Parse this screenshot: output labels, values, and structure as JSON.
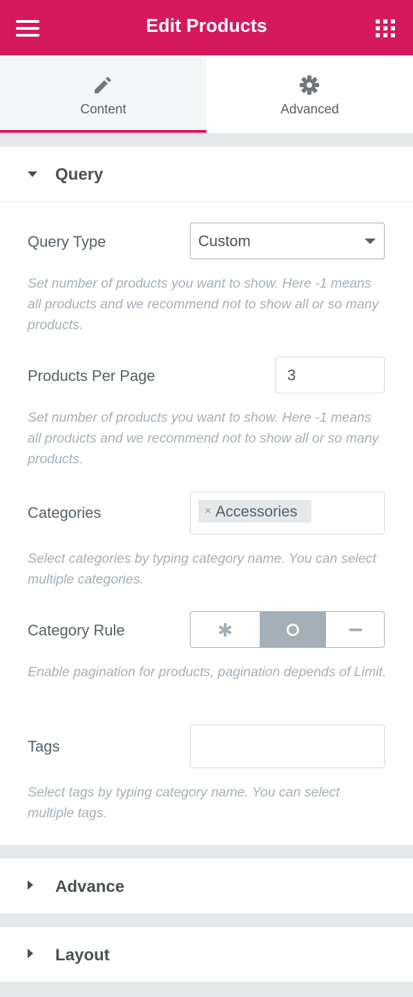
{
  "header": {
    "title": "Edit Products",
    "menu_icon": "hamburger-menu-icon",
    "apps_icon": "grid-icon",
    "background": "#d5195c"
  },
  "tabs": [
    {
      "label": "Content",
      "icon": "pencil-icon",
      "active": true
    },
    {
      "label": "Advanced",
      "icon": "gear-icon",
      "active": false
    }
  ],
  "sections": {
    "query": {
      "title": "Query",
      "expanded": true,
      "fields": {
        "query_type": {
          "label": "Query Type",
          "value": "Custom",
          "description": "Set number of products you want to show. Here -1 means all products and we recommend not to show all or so many products."
        },
        "products_per_page": {
          "label": "Products Per Page",
          "value": "3",
          "description": "Set number of products you want to show. Here -1 means all products and we recommend not to show all or so many products."
        },
        "categories": {
          "label": "Categories",
          "selected": [
            "Accessories"
          ],
          "remove_glyph": "×",
          "description": "Select categories by typing category name. You can select multiple categories."
        },
        "category_rule": {
          "label": "Category Rule",
          "options": [
            "asterisk-icon",
            "circle-icon",
            "minus-icon"
          ],
          "selected_index": 1,
          "description": "Enable pagination for products, pagination depends of Limit."
        },
        "tags": {
          "label": "Tags",
          "value": "",
          "description": "Select tags by typing category name. You can select multiple tags."
        }
      }
    },
    "advance": {
      "title": "Advance",
      "expanded": false
    },
    "layout": {
      "title": "Layout",
      "expanded": false
    }
  },
  "colors": {
    "accent": "#d5195c",
    "active_option": "#a4afb7",
    "help_text": "#a4afb7",
    "page_bg": "#e6e9ec"
  }
}
